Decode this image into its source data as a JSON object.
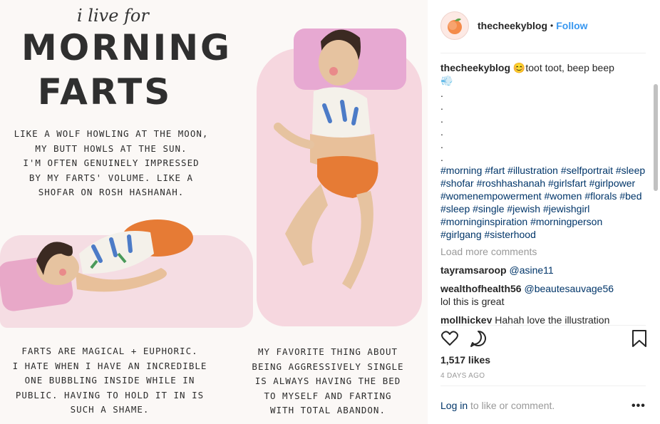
{
  "post_image": {
    "script_title": "i live for",
    "title_line1": "MORNING",
    "title_line2": "FARTS",
    "paragraph1": [
      "LIKE A WOLF HOWLING AT THE MOON,",
      "MY BUTT HOWLS AT THE SUN.",
      "I'M OFTEN GENUINELY IMPRESSED",
      "BY MY FARTS' VOLUME. LIKE A",
      "SHOFAR ON ROSH HASHANAH."
    ],
    "paragraph2": [
      "FARTS ARE MAGICAL + EUPHORIC.",
      "I HATE WHEN I HAVE AN INCREDIBLE",
      "ONE BUBBLING INSIDE WHILE IN",
      "PUBLIC. HAVING TO HOLD IT IN IS",
      "SUCH A SHAME."
    ],
    "paragraph3": [
      "MY FAVORITE THING ABOUT",
      "BEING AGGRESSIVELY SINGLE",
      "IS ALWAYS HAVING THE BED",
      "TO MYSELF AND FARTING",
      "WITH TOTAL ABANDON."
    ]
  },
  "header": {
    "username": "thecheekyblog",
    "separator": "•",
    "follow_label": "Follow",
    "avatar_icon": "peach-icon"
  },
  "caption": {
    "username": "thecheekyblog",
    "text": "toot toot, beep beep",
    "emoji_face": "😊",
    "emoji_dash": "💨",
    "dots": [
      ".",
      ".",
      ".",
      ".",
      ".",
      "."
    ],
    "hashtags": "#morning #fart #illustration #selfportrait #sleep #shofar #roshhashanah #girlsfart #girlpower #womenempowerment #women #florals #bed #sleep #single #jewish #jewishgirl #morninginspiration #morningperson #girlgang #sisterhood"
  },
  "load_more_label": "Load more comments",
  "comments": [
    {
      "user": "tayramsaroop",
      "mention": "@asine11",
      "text": ""
    },
    {
      "user": "wealthofhealth56",
      "mention": "@beautesauvage56",
      "text": "lol this is great"
    },
    {
      "user": "mollhickey",
      "mention": "",
      "text": "Hahah love the illustration"
    }
  ],
  "likes": "1,517 likes",
  "time_ago": "4 DAYS AGO",
  "login": {
    "link": "Log in",
    "rest": " to like or comment."
  },
  "more_label": "•••",
  "icons": {
    "like": "heart-icon",
    "comment": "comment-icon",
    "save": "bookmark-icon"
  },
  "colors": {
    "link": "#003569",
    "follow": "#3897f0",
    "muted": "#999999",
    "text": "#262626"
  }
}
